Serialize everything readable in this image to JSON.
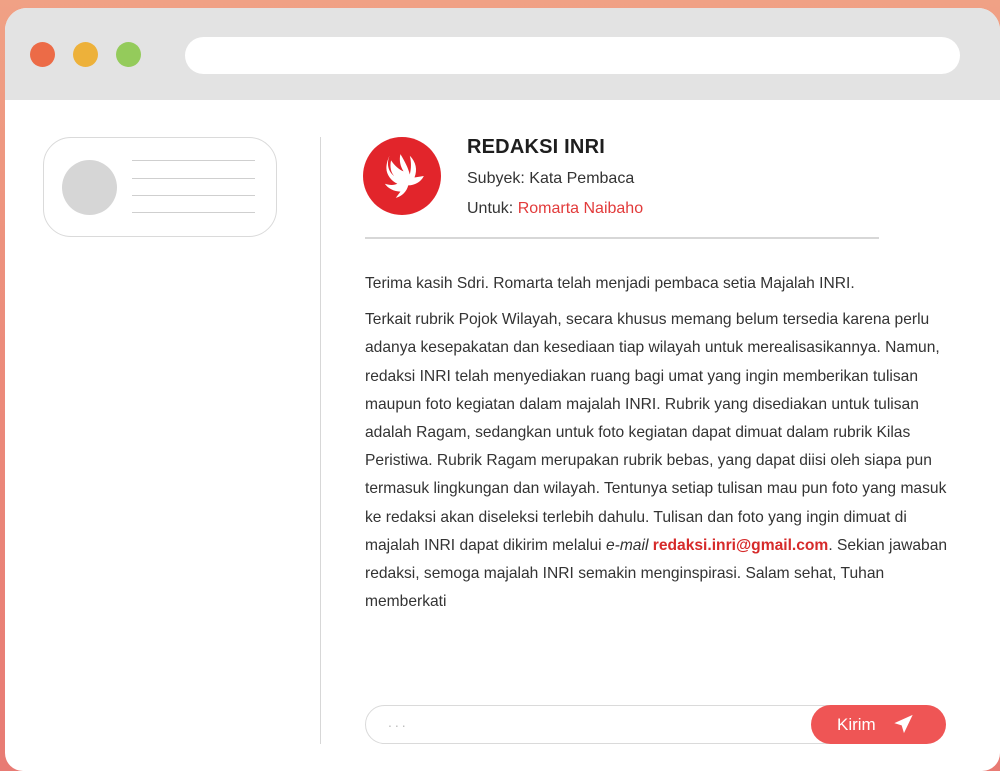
{
  "colors": {
    "background_gradient_top": "#F0A185",
    "background_gradient_bottom": "#E87B74",
    "accent": "#EF5555",
    "link": "#E23B3B",
    "email": "#D62A2A"
  },
  "window": {
    "controls": [
      "close",
      "minimize",
      "maximize"
    ],
    "address_bar": ""
  },
  "message": {
    "sender": "REDAKSI INRI",
    "subject_label": "Subyek:",
    "subject": "Kata Pembaca",
    "to_label": "Untuk:",
    "to": "Romarta Naibaho",
    "logo_icon": "dove-logo-icon",
    "paragraph1": "Terima kasih Sdri. Romarta telah menjadi pembaca setia Majalah INRI.",
    "paragraph2_part1": "Terkait rubrik Pojok Wilayah, secara khusus memang belum tersedia karena perlu adanya kesepakatan dan kesediaan tiap wilayah untuk merealisasikannya. Namun, redaksi INRI telah menyediakan ruang bagi umat yang ingin memberikan tulisan maupun foto kegiatan dalam majalah INRI. Rubrik yang disediakan untuk tulisan adalah Ragam, sedangkan untuk foto kegiatan dapat dimuat dalam rubrik Kilas Peristiwa. Rubrik Ragam merupakan rubrik bebas, yang dapat diisi oleh siapa pun termasuk lingkungan dan wilayah. Tentunya setiap tulisan mau pun foto yang masuk ke redaksi akan diseleksi terlebih dahulu. Tulisan dan foto yang ingin dimuat di majalah INRI dapat dikirim melalui",
    "paragraph2_emailterm": "e-mail",
    "paragraph2_email": "redaksi.inri@gmail.com",
    "paragraph2_part2": ". Sekian jawaban redaksi, semoga majalah INRI semakin menginspirasi. Salam sehat, Tuhan memberkati"
  },
  "reply": {
    "placeholder": "...",
    "send_label": "Kirim",
    "send_icon": "paper-plane-icon"
  }
}
